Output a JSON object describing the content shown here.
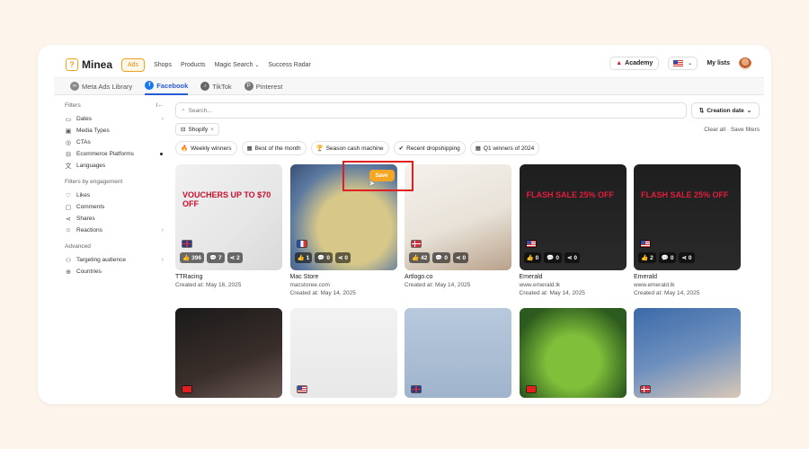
{
  "brand": {
    "name": "Minea",
    "logo_glyph": "?"
  },
  "nav": {
    "items": [
      {
        "label": "Ads",
        "active": true
      },
      {
        "label": "Shops"
      },
      {
        "label": "Products"
      },
      {
        "label": "Magic Search",
        "dropdown": true
      },
      {
        "label": "Success Radar"
      }
    ]
  },
  "top_right": {
    "academy_label": "Academy",
    "lang_chevron": "⌄",
    "my_lists_label": "My lists"
  },
  "tabs": [
    {
      "label": "Meta Ads Library",
      "icon": "meta-icon"
    },
    {
      "label": "Facebook",
      "icon": "facebook-icon",
      "active": true
    },
    {
      "label": "TikTok",
      "icon": "tiktok-icon"
    },
    {
      "label": "Pinterest",
      "icon": "pinterest-icon"
    }
  ],
  "sidebar": {
    "filters_heading": "Filters",
    "collapse_glyph": "I←",
    "filters": [
      {
        "label": "Dates",
        "icon": "calendar-icon",
        "glyph": "▭",
        "arrow": "›"
      },
      {
        "label": "Media Types",
        "icon": "media-icon",
        "glyph": "▣"
      },
      {
        "label": "CTAs",
        "icon": "cta-icon",
        "glyph": "◎"
      },
      {
        "label": "Ecommerce Platforms",
        "icon": "cart-icon",
        "glyph": "⊟",
        "dot": true
      },
      {
        "label": "Languages",
        "icon": "translate-icon",
        "glyph": "文"
      }
    ],
    "engagement_heading": "Filters by engagement",
    "engagement": [
      {
        "label": "Likes",
        "icon": "like-icon",
        "glyph": "♡"
      },
      {
        "label": "Comments",
        "icon": "comment-icon",
        "glyph": "▢"
      },
      {
        "label": "Shares",
        "icon": "share-icon",
        "glyph": "⋖"
      },
      {
        "label": "Reactions",
        "icon": "reaction-icon",
        "glyph": "☺",
        "arrow": "›"
      }
    ],
    "advanced_heading": "Advanced",
    "advanced": [
      {
        "label": "Targeting audience",
        "icon": "user-icon",
        "glyph": "⚇",
        "arrow": "›"
      },
      {
        "label": "Countries",
        "icon": "globe-icon",
        "glyph": "⊕"
      }
    ]
  },
  "search": {
    "placeholder": "Search..."
  },
  "sort": {
    "label": "Creation date"
  },
  "active_filter": {
    "label": "Shopify",
    "remove": "×"
  },
  "filter_links": {
    "clear": "Clear all",
    "separator": "·",
    "save": "Save filters"
  },
  "quick_tags": [
    {
      "label": "Weekly winners",
      "glyph": "🔥"
    },
    {
      "label": "Best of the month",
      "glyph": "▦"
    },
    {
      "label": "Season cash machine",
      "glyph": "🏆"
    },
    {
      "label": "Recent dropshipping",
      "glyph": "✔"
    },
    {
      "label": "Q1 winners of 2024",
      "glyph": "▦"
    }
  ],
  "save_button": {
    "label": "Save"
  },
  "cards": [
    {
      "title": "TTRacing",
      "url": "",
      "created": "Created at: May 16, 2025",
      "likes": "396",
      "comments": "7",
      "shares": "2",
      "flag": "uk",
      "bg": "linear-gradient(135deg,#f1f1f1 0%,#e6e6e6 60%,#d8d8d8 100%)",
      "overlay": "VOUCHERS UP TO $70 OFF",
      "overlay_color": "#c8102e"
    },
    {
      "title": "Mac Store",
      "url": "macstoree.com",
      "created": "Created at: May 14, 2025",
      "likes": "1",
      "comments": "0",
      "shares": "0",
      "flag": "fr",
      "bg": "radial-gradient(ellipse at 60% 60%,#d7c88a 0 40%,#5c7aa0 70%,#3a4e74 100%)",
      "overlay": "",
      "overlay_color": ""
    },
    {
      "title": "Artlogo.co",
      "url": "",
      "created": "Created at: May 14, 2025",
      "likes": "42",
      "comments": "0",
      "shares": "0",
      "flag": "dk",
      "bg": "linear-gradient(160deg,#f4f1ec 0%,#e8e2d8 55%,#b9a18a 100%)",
      "overlay": "",
      "overlay_color": ""
    },
    {
      "title": "Emerald",
      "url": "www.emerald.lk",
      "created": "Created at: May 14, 2025",
      "likes": "0",
      "comments": "0",
      "shares": "0",
      "flag": "us",
      "bg": "linear-gradient(180deg,#1e1e1e 0%,#2a2a2a 100%)",
      "overlay": "FLASH SALE 25% OFF",
      "overlay_color": "#e01e3c"
    },
    {
      "title": "Emerald",
      "url": "www.emerald.lk",
      "created": "Created at: May 14, 2025",
      "likes": "2",
      "comments": "0",
      "shares": "0",
      "flag": "us",
      "bg": "linear-gradient(180deg,#1e1e1e 0%,#2a2a2a 100%)",
      "overlay": "FLASH SALE 25% OFF",
      "overlay_color": "#e01e3c"
    }
  ],
  "cards_row2": [
    {
      "flag": "yt",
      "bg": "linear-gradient(160deg,#1a1a1a 0%,#3a2e2a 60%,#6a5a55 100%)"
    },
    {
      "flag": "us",
      "bg": "linear-gradient(180deg,#f2f2f2 0%,#e8e8e8 100%)"
    },
    {
      "flag": "uk",
      "bg": "linear-gradient(180deg,#b8c9dd 0%,#9fb4cc 100%)"
    },
    {
      "flag": "yt",
      "bg": "radial-gradient(circle at 50% 60%,#7fbf3a 0 35%,#2d5a1e 80%)"
    },
    {
      "flag": "dk",
      "bg": "linear-gradient(160deg,#3b6aa8 0%,#6d8fbe 50%,#d9c8b8 100%)"
    }
  ]
}
